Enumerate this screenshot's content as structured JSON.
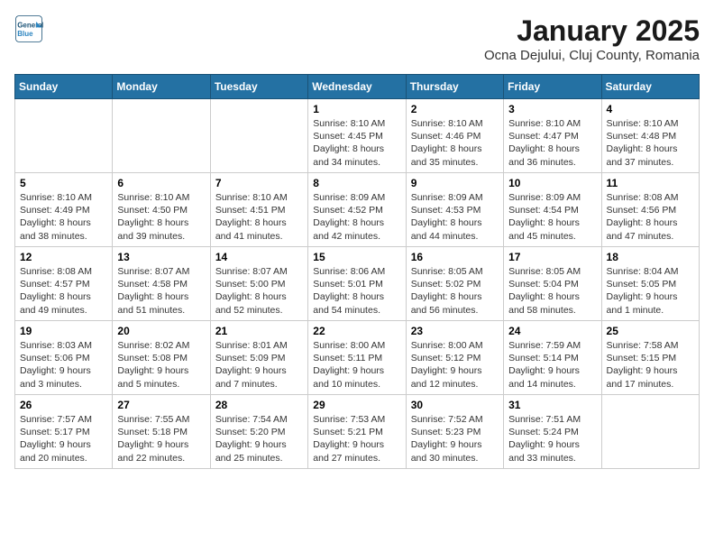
{
  "header": {
    "logo_line1": "General",
    "logo_line2": "Blue",
    "title": "January 2025",
    "subtitle": "Ocna Dejului, Cluj County, Romania"
  },
  "weekdays": [
    "Sunday",
    "Monday",
    "Tuesday",
    "Wednesday",
    "Thursday",
    "Friday",
    "Saturday"
  ],
  "weeks": [
    [
      {
        "day": "",
        "info": ""
      },
      {
        "day": "",
        "info": ""
      },
      {
        "day": "",
        "info": ""
      },
      {
        "day": "1",
        "info": "Sunrise: 8:10 AM\nSunset: 4:45 PM\nDaylight: 8 hours\nand 34 minutes."
      },
      {
        "day": "2",
        "info": "Sunrise: 8:10 AM\nSunset: 4:46 PM\nDaylight: 8 hours\nand 35 minutes."
      },
      {
        "day": "3",
        "info": "Sunrise: 8:10 AM\nSunset: 4:47 PM\nDaylight: 8 hours\nand 36 minutes."
      },
      {
        "day": "4",
        "info": "Sunrise: 8:10 AM\nSunset: 4:48 PM\nDaylight: 8 hours\nand 37 minutes."
      }
    ],
    [
      {
        "day": "5",
        "info": "Sunrise: 8:10 AM\nSunset: 4:49 PM\nDaylight: 8 hours\nand 38 minutes."
      },
      {
        "day": "6",
        "info": "Sunrise: 8:10 AM\nSunset: 4:50 PM\nDaylight: 8 hours\nand 39 minutes."
      },
      {
        "day": "7",
        "info": "Sunrise: 8:10 AM\nSunset: 4:51 PM\nDaylight: 8 hours\nand 41 minutes."
      },
      {
        "day": "8",
        "info": "Sunrise: 8:09 AM\nSunset: 4:52 PM\nDaylight: 8 hours\nand 42 minutes."
      },
      {
        "day": "9",
        "info": "Sunrise: 8:09 AM\nSunset: 4:53 PM\nDaylight: 8 hours\nand 44 minutes."
      },
      {
        "day": "10",
        "info": "Sunrise: 8:09 AM\nSunset: 4:54 PM\nDaylight: 8 hours\nand 45 minutes."
      },
      {
        "day": "11",
        "info": "Sunrise: 8:08 AM\nSunset: 4:56 PM\nDaylight: 8 hours\nand 47 minutes."
      }
    ],
    [
      {
        "day": "12",
        "info": "Sunrise: 8:08 AM\nSunset: 4:57 PM\nDaylight: 8 hours\nand 49 minutes."
      },
      {
        "day": "13",
        "info": "Sunrise: 8:07 AM\nSunset: 4:58 PM\nDaylight: 8 hours\nand 51 minutes."
      },
      {
        "day": "14",
        "info": "Sunrise: 8:07 AM\nSunset: 5:00 PM\nDaylight: 8 hours\nand 52 minutes."
      },
      {
        "day": "15",
        "info": "Sunrise: 8:06 AM\nSunset: 5:01 PM\nDaylight: 8 hours\nand 54 minutes."
      },
      {
        "day": "16",
        "info": "Sunrise: 8:05 AM\nSunset: 5:02 PM\nDaylight: 8 hours\nand 56 minutes."
      },
      {
        "day": "17",
        "info": "Sunrise: 8:05 AM\nSunset: 5:04 PM\nDaylight: 8 hours\nand 58 minutes."
      },
      {
        "day": "18",
        "info": "Sunrise: 8:04 AM\nSunset: 5:05 PM\nDaylight: 9 hours\nand 1 minute."
      }
    ],
    [
      {
        "day": "19",
        "info": "Sunrise: 8:03 AM\nSunset: 5:06 PM\nDaylight: 9 hours\nand 3 minutes."
      },
      {
        "day": "20",
        "info": "Sunrise: 8:02 AM\nSunset: 5:08 PM\nDaylight: 9 hours\nand 5 minutes."
      },
      {
        "day": "21",
        "info": "Sunrise: 8:01 AM\nSunset: 5:09 PM\nDaylight: 9 hours\nand 7 minutes."
      },
      {
        "day": "22",
        "info": "Sunrise: 8:00 AM\nSunset: 5:11 PM\nDaylight: 9 hours\nand 10 minutes."
      },
      {
        "day": "23",
        "info": "Sunrise: 8:00 AM\nSunset: 5:12 PM\nDaylight: 9 hours\nand 12 minutes."
      },
      {
        "day": "24",
        "info": "Sunrise: 7:59 AM\nSunset: 5:14 PM\nDaylight: 9 hours\nand 14 minutes."
      },
      {
        "day": "25",
        "info": "Sunrise: 7:58 AM\nSunset: 5:15 PM\nDaylight: 9 hours\nand 17 minutes."
      }
    ],
    [
      {
        "day": "26",
        "info": "Sunrise: 7:57 AM\nSunset: 5:17 PM\nDaylight: 9 hours\nand 20 minutes."
      },
      {
        "day": "27",
        "info": "Sunrise: 7:55 AM\nSunset: 5:18 PM\nDaylight: 9 hours\nand 22 minutes."
      },
      {
        "day": "28",
        "info": "Sunrise: 7:54 AM\nSunset: 5:20 PM\nDaylight: 9 hours\nand 25 minutes."
      },
      {
        "day": "29",
        "info": "Sunrise: 7:53 AM\nSunset: 5:21 PM\nDaylight: 9 hours\nand 27 minutes."
      },
      {
        "day": "30",
        "info": "Sunrise: 7:52 AM\nSunset: 5:23 PM\nDaylight: 9 hours\nand 30 minutes."
      },
      {
        "day": "31",
        "info": "Sunrise: 7:51 AM\nSunset: 5:24 PM\nDaylight: 9 hours\nand 33 minutes."
      },
      {
        "day": "",
        "info": ""
      }
    ]
  ]
}
